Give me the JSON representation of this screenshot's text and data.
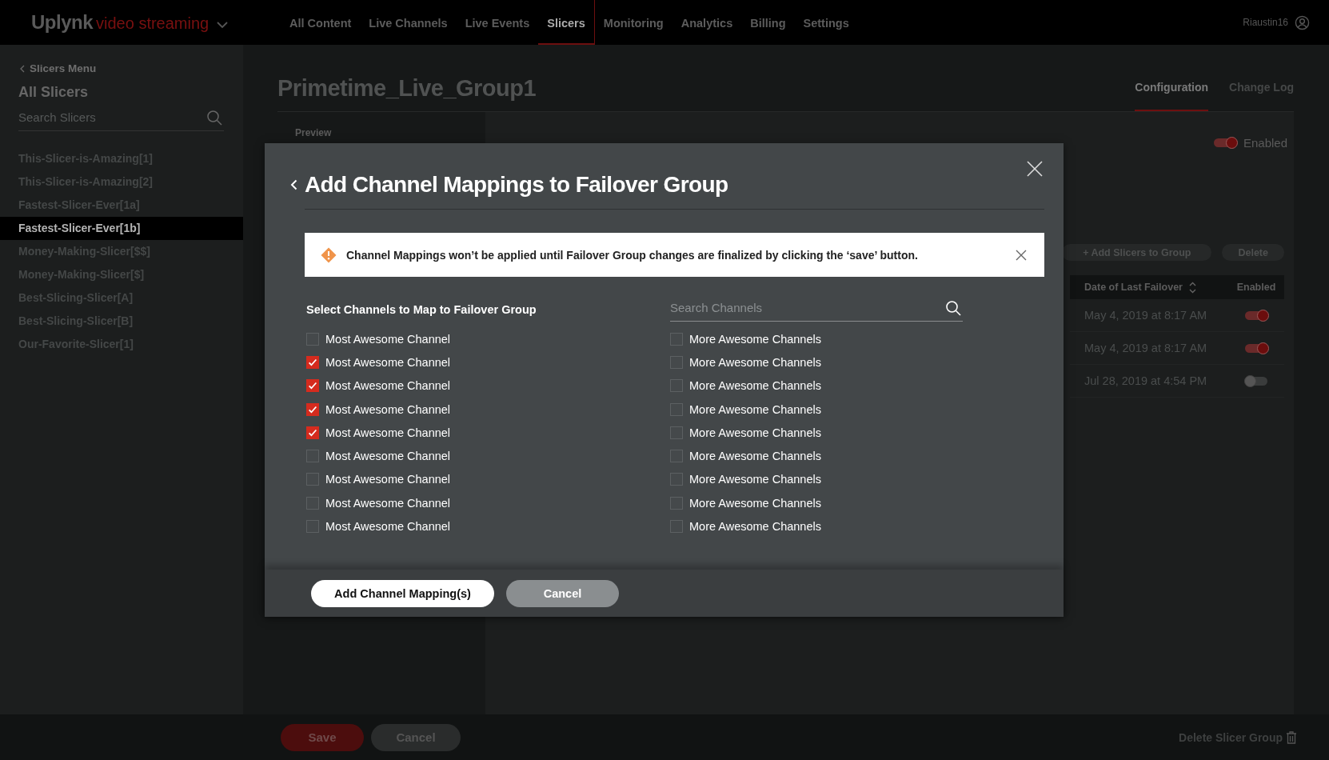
{
  "top_bar": {
    "logo": "Uplynk",
    "product": "video streaming",
    "nav": [
      {
        "label": "All Content",
        "selected": false
      },
      {
        "label": "Live Channels",
        "selected": false
      },
      {
        "label": "Live Events",
        "selected": false
      },
      {
        "label": "Slicers",
        "selected": true
      },
      {
        "label": "Monitoring",
        "selected": false
      },
      {
        "label": "Analytics",
        "selected": false
      },
      {
        "label": "Billing",
        "selected": false
      },
      {
        "label": "Settings",
        "selected": false
      }
    ],
    "user": "Riaustin16"
  },
  "sidebar": {
    "back": "Slicers Menu",
    "title": "All Slicers",
    "search": {
      "placeholder": "Search Slicers"
    },
    "items": [
      {
        "label": "This-Slicer-is-Amazing[1]",
        "selected": false
      },
      {
        "label": "This-Slicer-is-Amazing[2]",
        "selected": false
      },
      {
        "label": "Fastest-Slicer-Ever[1a]",
        "selected": false
      },
      {
        "label": "Fastest-Slicer-Ever[1b]",
        "selected": true
      },
      {
        "label": "Money-Making-Slicer[$$]",
        "selected": false
      },
      {
        "label": "Money-Making-Slicer[$]",
        "selected": false
      },
      {
        "label": "Best-Slicing-Slicer[A]",
        "selected": false
      },
      {
        "label": "Best-Slicing-Slicer[B]",
        "selected": false
      },
      {
        "label": "Our-Favorite-Slicer[1]",
        "selected": false
      }
    ]
  },
  "main": {
    "title": "Primetime_Live_Group1",
    "tabs": [
      {
        "label": "Configuration",
        "selected": true
      },
      {
        "label": "Change Log",
        "selected": false
      }
    ],
    "preview": "Preview",
    "enabled_toggle": {
      "label": "Enabled",
      "on": true
    },
    "buttons": [
      "+ Add Slicers to Group",
      "Delete"
    ],
    "table": {
      "columns": [
        "Date of Last Failover",
        "Enabled"
      ],
      "rows": [
        {
          "date": "May 4, 2019 at 8:17 AM",
          "enabled": true
        },
        {
          "date": "May 4, 2019 at 8:17 AM",
          "enabled": true
        },
        {
          "date": "Jul 28, 2019 at 4:54 PM",
          "enabled": false
        }
      ]
    }
  },
  "modal": {
    "title": "Add Channel Mappings to Failover Group",
    "alert": "Channel Mappings won’t be applied until Failover Group changes are finalized by clicking the ‘save’ button.",
    "list_label": "Select Channels to Map to Failover Group",
    "search": {
      "placeholder": "Search Channels"
    },
    "left_channels": [
      {
        "label": "Most Awesome Channel",
        "checked": false
      },
      {
        "label": "Most Awesome Channel",
        "checked": true
      },
      {
        "label": "Most Awesome Channel",
        "checked": true
      },
      {
        "label": "Most Awesome Channel",
        "checked": true
      },
      {
        "label": "Most Awesome Channel",
        "checked": true
      },
      {
        "label": "Most Awesome Channel",
        "checked": false
      },
      {
        "label": "Most Awesome Channel",
        "checked": false
      },
      {
        "label": "Most Awesome Channel",
        "checked": false
      },
      {
        "label": "Most Awesome Channel",
        "checked": false
      }
    ],
    "right_channels": [
      {
        "label": "More Awesome Channels",
        "checked": false
      },
      {
        "label": "More Awesome Channels",
        "checked": false
      },
      {
        "label": "More Awesome Channels",
        "checked": false
      },
      {
        "label": "More Awesome Channels",
        "checked": false
      },
      {
        "label": "More Awesome Channels",
        "checked": false
      },
      {
        "label": "More Awesome Channels",
        "checked": false
      },
      {
        "label": "More Awesome Channels",
        "checked": false
      },
      {
        "label": "More Awesome Channels",
        "checked": false
      },
      {
        "label": "More Awesome Channels",
        "checked": false
      }
    ],
    "primary_button": "Add Channel Mapping(s)",
    "cancel_button": "Cancel"
  },
  "footer": {
    "save": "Save",
    "cancel": "Cancel",
    "delete": "Delete Slicer Group"
  }
}
